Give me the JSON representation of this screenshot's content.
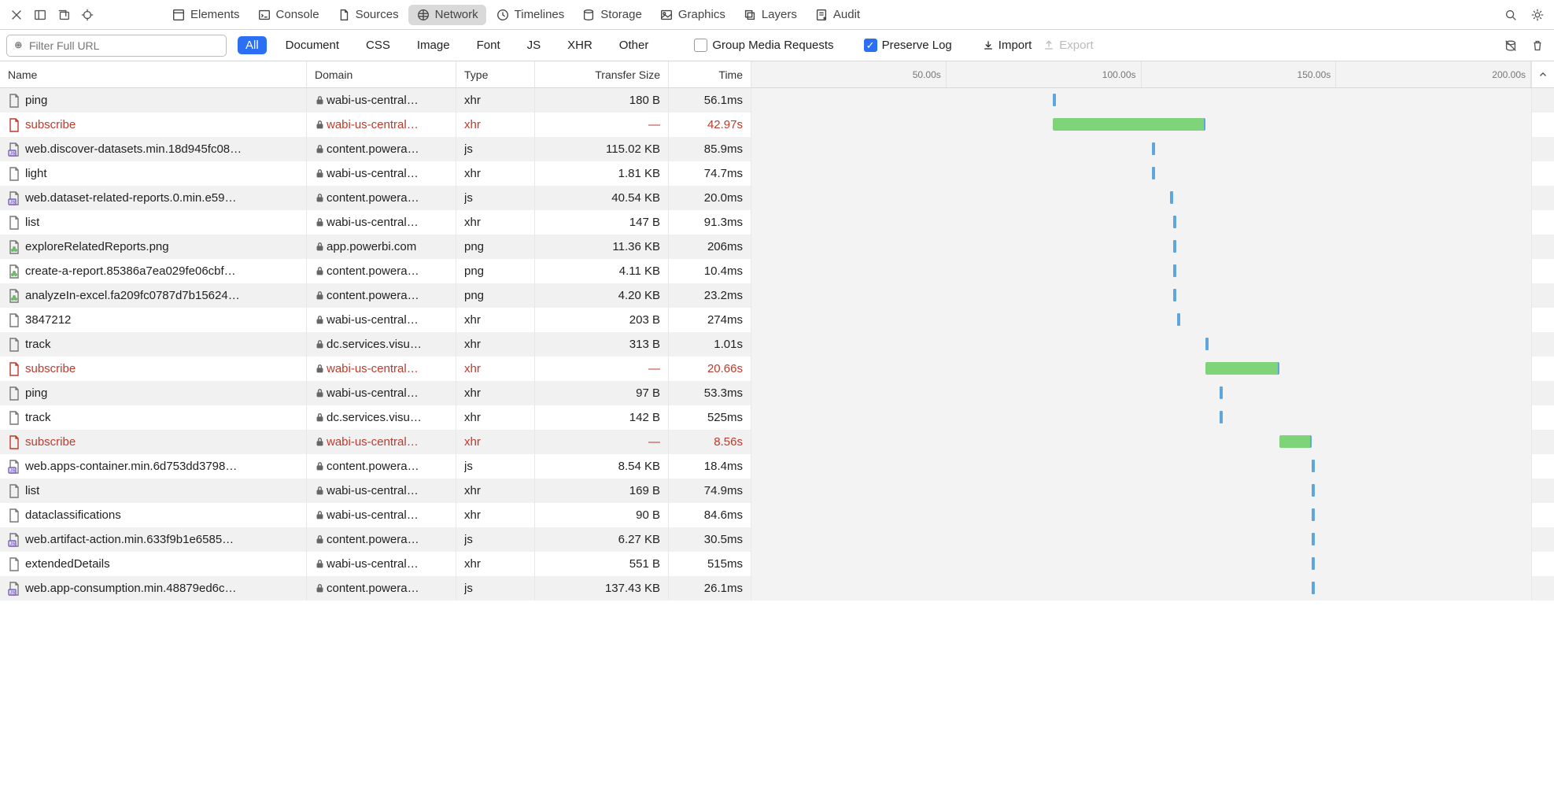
{
  "tabs": {
    "elements": "Elements",
    "console": "Console",
    "sources": "Sources",
    "network": "Network",
    "timelines": "Timelines",
    "storage": "Storage",
    "graphics": "Graphics",
    "layers": "Layers",
    "audit": "Audit"
  },
  "filter": {
    "placeholder": "Filter Full URL"
  },
  "filterPills": {
    "all": "All",
    "document": "Document",
    "css": "CSS",
    "image": "Image",
    "font": "Font",
    "js": "JS",
    "xhr": "XHR",
    "other": "Other"
  },
  "options": {
    "groupMedia": "Group Media Requests",
    "preserveLog": "Preserve Log",
    "import": "Import",
    "export": "Export"
  },
  "columns": {
    "name": "Name",
    "domain": "Domain",
    "type": "Type",
    "size": "Transfer Size",
    "time": "Time"
  },
  "waterfall": {
    "ticks": [
      "50.00s",
      "100.00s",
      "150.00s",
      "200.00s"
    ],
    "range": 220
  },
  "requests": [
    {
      "name": "ping",
      "domain": "wabi-us-central…",
      "type": "xhr",
      "size": "180 B",
      "time": "56.1ms",
      "fileKind": "doc",
      "error": false,
      "wfStart": 85,
      "wfDur": 0.3
    },
    {
      "name": "subscribe",
      "domain": "wabi-us-central…",
      "type": "xhr",
      "size": "—",
      "time": "42.97s",
      "fileKind": "doc",
      "error": true,
      "wfStart": 85,
      "wfDur": 43
    },
    {
      "name": "web.discover-datasets.min.18d945fc08…",
      "domain": "content.powera…",
      "type": "js",
      "size": "115.02 KB",
      "time": "85.9ms",
      "fileKind": "js",
      "error": false,
      "wfStart": 113,
      "wfDur": 0.3
    },
    {
      "name": "light",
      "domain": "wabi-us-central…",
      "type": "xhr",
      "size": "1.81 KB",
      "time": "74.7ms",
      "fileKind": "doc",
      "error": false,
      "wfStart": 113,
      "wfDur": 0.3
    },
    {
      "name": "web.dataset-related-reports.0.min.e59…",
      "domain": "content.powera…",
      "type": "js",
      "size": "40.54 KB",
      "time": "20.0ms",
      "fileKind": "js",
      "error": false,
      "wfStart": 118,
      "wfDur": 0.3
    },
    {
      "name": "list",
      "domain": "wabi-us-central…",
      "type": "xhr",
      "size": "147 B",
      "time": "91.3ms",
      "fileKind": "doc",
      "error": false,
      "wfStart": 119,
      "wfDur": 0.3
    },
    {
      "name": "exploreRelatedReports.png",
      "domain": "app.powerbi.com",
      "type": "png",
      "size": "11.36 KB",
      "time": "206ms",
      "fileKind": "png",
      "error": false,
      "wfStart": 119,
      "wfDur": 0.3
    },
    {
      "name": "create-a-report.85386a7ea029fe06cbf…",
      "domain": "content.powera…",
      "type": "png",
      "size": "4.11 KB",
      "time": "10.4ms",
      "fileKind": "png",
      "error": false,
      "wfStart": 119,
      "wfDur": 0.3
    },
    {
      "name": "analyzeIn-excel.fa209fc0787d7b15624…",
      "domain": "content.powera…",
      "type": "png",
      "size": "4.20 KB",
      "time": "23.2ms",
      "fileKind": "png",
      "error": false,
      "wfStart": 119,
      "wfDur": 0.3
    },
    {
      "name": "3847212",
      "domain": "wabi-us-central…",
      "type": "xhr",
      "size": "203 B",
      "time": "274ms",
      "fileKind": "doc",
      "error": false,
      "wfStart": 120,
      "wfDur": 0.3
    },
    {
      "name": "track",
      "domain": "dc.services.visu…",
      "type": "xhr",
      "size": "313 B",
      "time": "1.01s",
      "fileKind": "doc",
      "error": false,
      "wfStart": 128,
      "wfDur": 1
    },
    {
      "name": "subscribe",
      "domain": "wabi-us-central…",
      "type": "xhr",
      "size": "—",
      "time": "20.66s",
      "fileKind": "doc",
      "error": true,
      "wfStart": 128,
      "wfDur": 21
    },
    {
      "name": "ping",
      "domain": "wabi-us-central…",
      "type": "xhr",
      "size": "97 B",
      "time": "53.3ms",
      "fileKind": "doc",
      "error": false,
      "wfStart": 132,
      "wfDur": 0.3
    },
    {
      "name": "track",
      "domain": "dc.services.visu…",
      "type": "xhr",
      "size": "142 B",
      "time": "525ms",
      "fileKind": "doc",
      "error": false,
      "wfStart": 132,
      "wfDur": 0.5
    },
    {
      "name": "subscribe",
      "domain": "wabi-us-central…",
      "type": "xhr",
      "size": "—",
      "time": "8.56s",
      "fileKind": "doc",
      "error": true,
      "wfStart": 149,
      "wfDur": 9
    },
    {
      "name": "web.apps-container.min.6d753dd3798…",
      "domain": "content.powera…",
      "type": "js",
      "size": "8.54 KB",
      "time": "18.4ms",
      "fileKind": "js",
      "error": false,
      "wfStart": 158,
      "wfDur": 0.3
    },
    {
      "name": "list",
      "domain": "wabi-us-central…",
      "type": "xhr",
      "size": "169 B",
      "time": "74.9ms",
      "fileKind": "doc",
      "error": false,
      "wfStart": 158,
      "wfDur": 0.3
    },
    {
      "name": "dataclassifications",
      "domain": "wabi-us-central…",
      "type": "xhr",
      "size": "90 B",
      "time": "84.6ms",
      "fileKind": "doc",
      "error": false,
      "wfStart": 158,
      "wfDur": 0.3
    },
    {
      "name": "web.artifact-action.min.633f9b1e6585…",
      "domain": "content.powera…",
      "type": "js",
      "size": "6.27 KB",
      "time": "30.5ms",
      "fileKind": "js",
      "error": false,
      "wfStart": 158,
      "wfDur": 0.3
    },
    {
      "name": "extendedDetails",
      "domain": "wabi-us-central…",
      "type": "xhr",
      "size": "551 B",
      "time": "515ms",
      "fileKind": "doc",
      "error": false,
      "wfStart": 158,
      "wfDur": 0.5
    },
    {
      "name": "web.app-consumption.min.48879ed6c…",
      "domain": "content.powera…",
      "type": "js",
      "size": "137.43 KB",
      "time": "26.1ms",
      "fileKind": "js",
      "error": false,
      "wfStart": 158,
      "wfDur": 0.3
    }
  ]
}
